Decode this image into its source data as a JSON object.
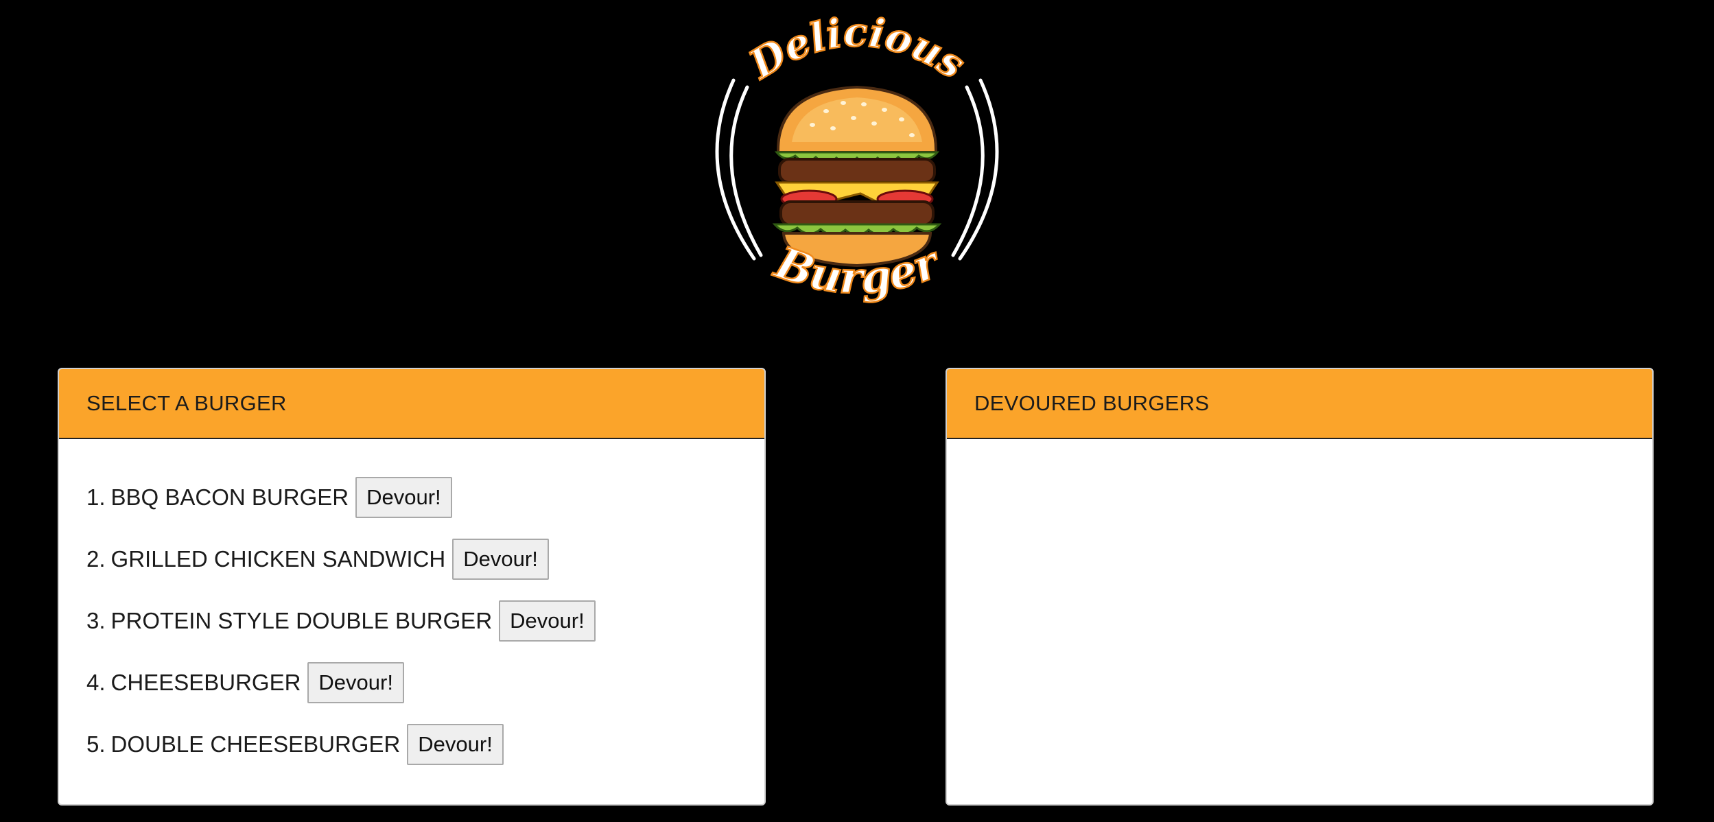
{
  "logo": {
    "top_word": "Delicious",
    "bottom_word": "Burger"
  },
  "select_panel": {
    "title": "SELECT A BURGER",
    "items": [
      {
        "number": "1.",
        "name": "BBQ BACON BURGER",
        "button_label": "Devour!"
      },
      {
        "number": "2.",
        "name": "GRILLED CHICKEN SANDWICH",
        "button_label": "Devour!"
      },
      {
        "number": "3.",
        "name": "PROTEIN STYLE DOUBLE BURGER",
        "button_label": "Devour!"
      },
      {
        "number": "4.",
        "name": "CHEESEBURGER",
        "button_label": "Devour!"
      },
      {
        "number": "5.",
        "name": "DOUBLE CHEESEBURGER",
        "button_label": "Devour!"
      }
    ]
  },
  "devoured_panel": {
    "title": "DEVOURED BURGERS",
    "items": []
  },
  "colors": {
    "background": "#000000",
    "panel_header": "#fba42a",
    "logo_text_outline": "#f08a1c"
  }
}
